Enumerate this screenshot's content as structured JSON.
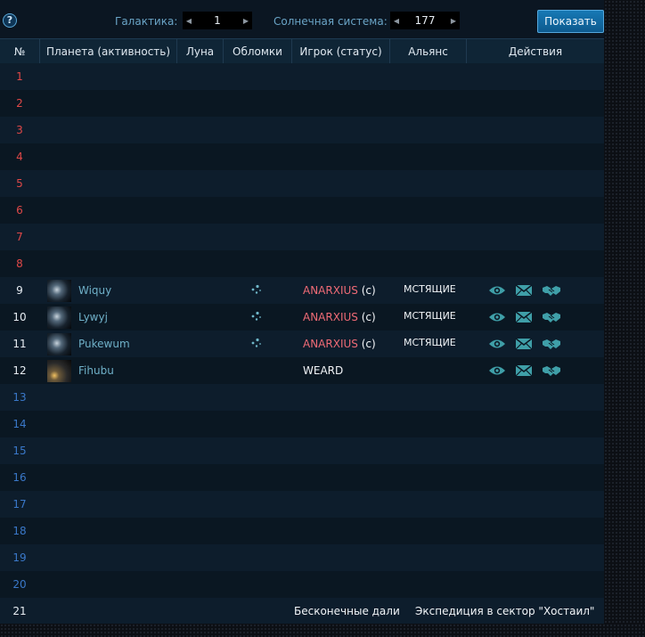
{
  "nav": {
    "help": "?",
    "galaxy_label": "Галактика:",
    "galaxy_value": "1",
    "system_label": "Солнечная система:",
    "system_value": "177",
    "show_button": "Показать"
  },
  "columns": [
    "№",
    "Планета (активность)",
    "Луна",
    "Обломки",
    "Игрок (статус)",
    "Альянс",
    "Действия"
  ],
  "colors": {
    "empty_pos": "#e04848",
    "occupied_pos": "#e6ecf2",
    "far_pos": "#3a78c9",
    "player_name": "#f06b76",
    "planet_name": "#6fb0c8",
    "icon": "#3f9fa8"
  },
  "rows": [
    {
      "pos": "1",
      "tone": "red"
    },
    {
      "pos": "2",
      "tone": "red"
    },
    {
      "pos": "3",
      "tone": "red"
    },
    {
      "pos": "4",
      "tone": "red"
    },
    {
      "pos": "5",
      "tone": "red"
    },
    {
      "pos": "6",
      "tone": "red"
    },
    {
      "pos": "7",
      "tone": "red"
    },
    {
      "pos": "8",
      "tone": "red"
    },
    {
      "pos": "9",
      "tone": "white",
      "planet": "Wiquy",
      "debris": true,
      "player": "ANARXIUS",
      "status": "(c)",
      "alliance": "МСТЯЩИЕ"
    },
    {
      "pos": "10",
      "tone": "white",
      "planet": "Lywyj",
      "debris": true,
      "player": "ANARXIUS",
      "status": "(c)",
      "alliance": "МСТЯЩИЕ"
    },
    {
      "pos": "11",
      "tone": "white",
      "planet": "Pukewum",
      "debris": true,
      "player": "ANARXIUS",
      "status": "(c)",
      "alliance": "МСТЯЩИЕ"
    },
    {
      "pos": "12",
      "tone": "white",
      "planet": "Fihubu",
      "debris": false,
      "player": "WEARD",
      "status": "",
      "alliance": "",
      "player_white": true
    },
    {
      "pos": "13",
      "tone": "blue"
    },
    {
      "pos": "14",
      "tone": "blue"
    },
    {
      "pos": "15",
      "tone": "blue"
    },
    {
      "pos": "16",
      "tone": "blue"
    },
    {
      "pos": "17",
      "tone": "blue"
    },
    {
      "pos": "18",
      "tone": "blue"
    },
    {
      "pos": "19",
      "tone": "blue"
    },
    {
      "pos": "20",
      "tone": "blue"
    }
  ],
  "footer": {
    "pos": "21",
    "far_space": "Бесконечные дали",
    "expedition": "Экспедиция в сектор \"Хостаил\""
  },
  "action_icons": [
    "eye-icon",
    "mail-icon",
    "handshake-icon"
  ]
}
